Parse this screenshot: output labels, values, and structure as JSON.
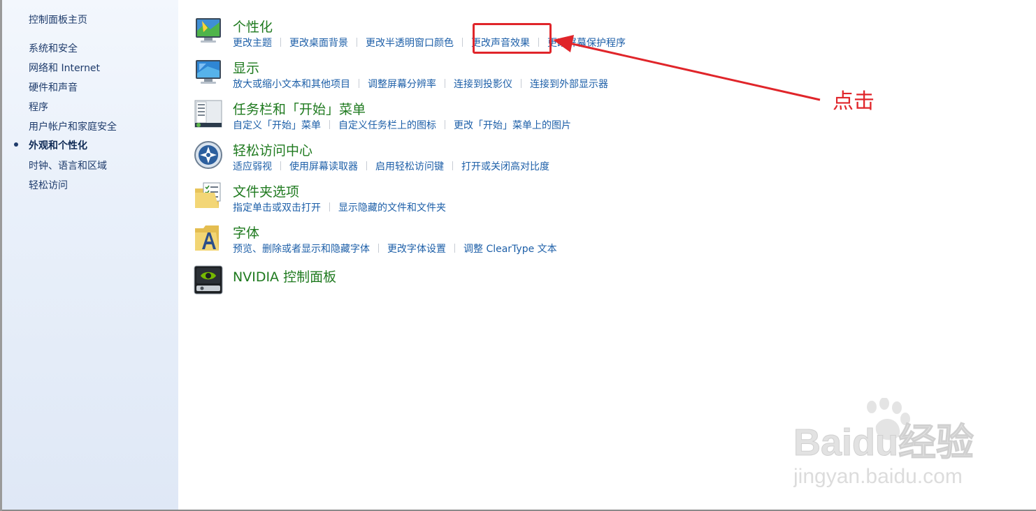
{
  "sidebar": {
    "items": [
      {
        "label": "控制面板主页",
        "active": false
      },
      {
        "label": "系统和安全",
        "active": false
      },
      {
        "label": "网络和 Internet",
        "active": false
      },
      {
        "label": "硬件和声音",
        "active": false
      },
      {
        "label": "程序",
        "active": false
      },
      {
        "label": "用户帐户和家庭安全",
        "active": false
      },
      {
        "label": "外观和个性化",
        "active": true
      },
      {
        "label": "时钟、语言和区域",
        "active": false
      },
      {
        "label": "轻松访问",
        "active": false
      }
    ]
  },
  "categories": [
    {
      "title": "个性化",
      "icon": "personalization-icon",
      "links": [
        "更改主题",
        "更改桌面背景",
        "更改半透明窗口颜色",
        "更改声音效果",
        "更改屏幕保护程序"
      ]
    },
    {
      "title": "显示",
      "icon": "display-icon",
      "links": [
        "放大或缩小文本和其他项目",
        "调整屏幕分辨率",
        "连接到投影仪",
        "连接到外部显示器"
      ]
    },
    {
      "title": "任务栏和「开始」菜单",
      "icon": "taskbar-icon",
      "links": [
        "自定义「开始」菜单",
        "自定义任务栏上的图标",
        "更改「开始」菜单上的图片"
      ]
    },
    {
      "title": "轻松访问中心",
      "icon": "ease-of-access-icon",
      "links": [
        "适应弱视",
        "使用屏幕读取器",
        "启用轻松访问键",
        "打开或关闭高对比度"
      ]
    },
    {
      "title": "文件夹选项",
      "icon": "folder-options-icon",
      "links": [
        "指定单击或双击打开",
        "显示隐藏的文件和文件夹"
      ]
    },
    {
      "title": "字体",
      "icon": "fonts-icon",
      "links": [
        "预览、删除或者显示和隐藏字体",
        "更改字体设置",
        "调整 ClearType 文本"
      ]
    },
    {
      "title": "NVIDIA 控制面板",
      "icon": "nvidia-icon",
      "links": []
    }
  ],
  "annotation": {
    "label": "点击",
    "color": "#e0252a"
  },
  "watermark": {
    "brand": "Baidu经验",
    "url": "jingyan.baidu.com"
  },
  "colors": {
    "category_title": "#1f7a1f",
    "link": "#1d5fa8",
    "sidebar_text": "#1e3b6b"
  }
}
